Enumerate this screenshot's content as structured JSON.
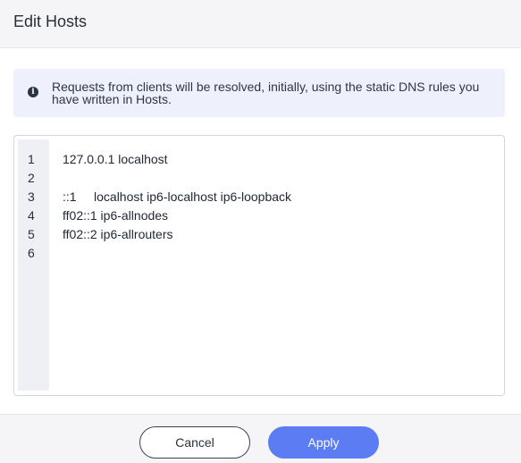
{
  "dialog": {
    "title": "Edit Hosts"
  },
  "notice": {
    "icon": "info-icon",
    "text": "Requests from clients will be resolved, initially, using the static DNS rules you have written in Hosts."
  },
  "editor": {
    "line_numbers": [
      "1",
      "2",
      "3",
      "4",
      "5",
      "6"
    ],
    "lines": [
      "127.0.0.1 localhost",
      "",
      "::1     localhost ip6-localhost ip6-loopback",
      "ff02::1 ip6-allnodes",
      "ff02::2 ip6-allrouters",
      ""
    ]
  },
  "footer": {
    "cancel_label": "Cancel",
    "apply_label": "Apply"
  },
  "colors": {
    "accent": "#5c7cf4",
    "notice_bg": "#eef1fb",
    "header_bg": "#f5f5f7"
  }
}
